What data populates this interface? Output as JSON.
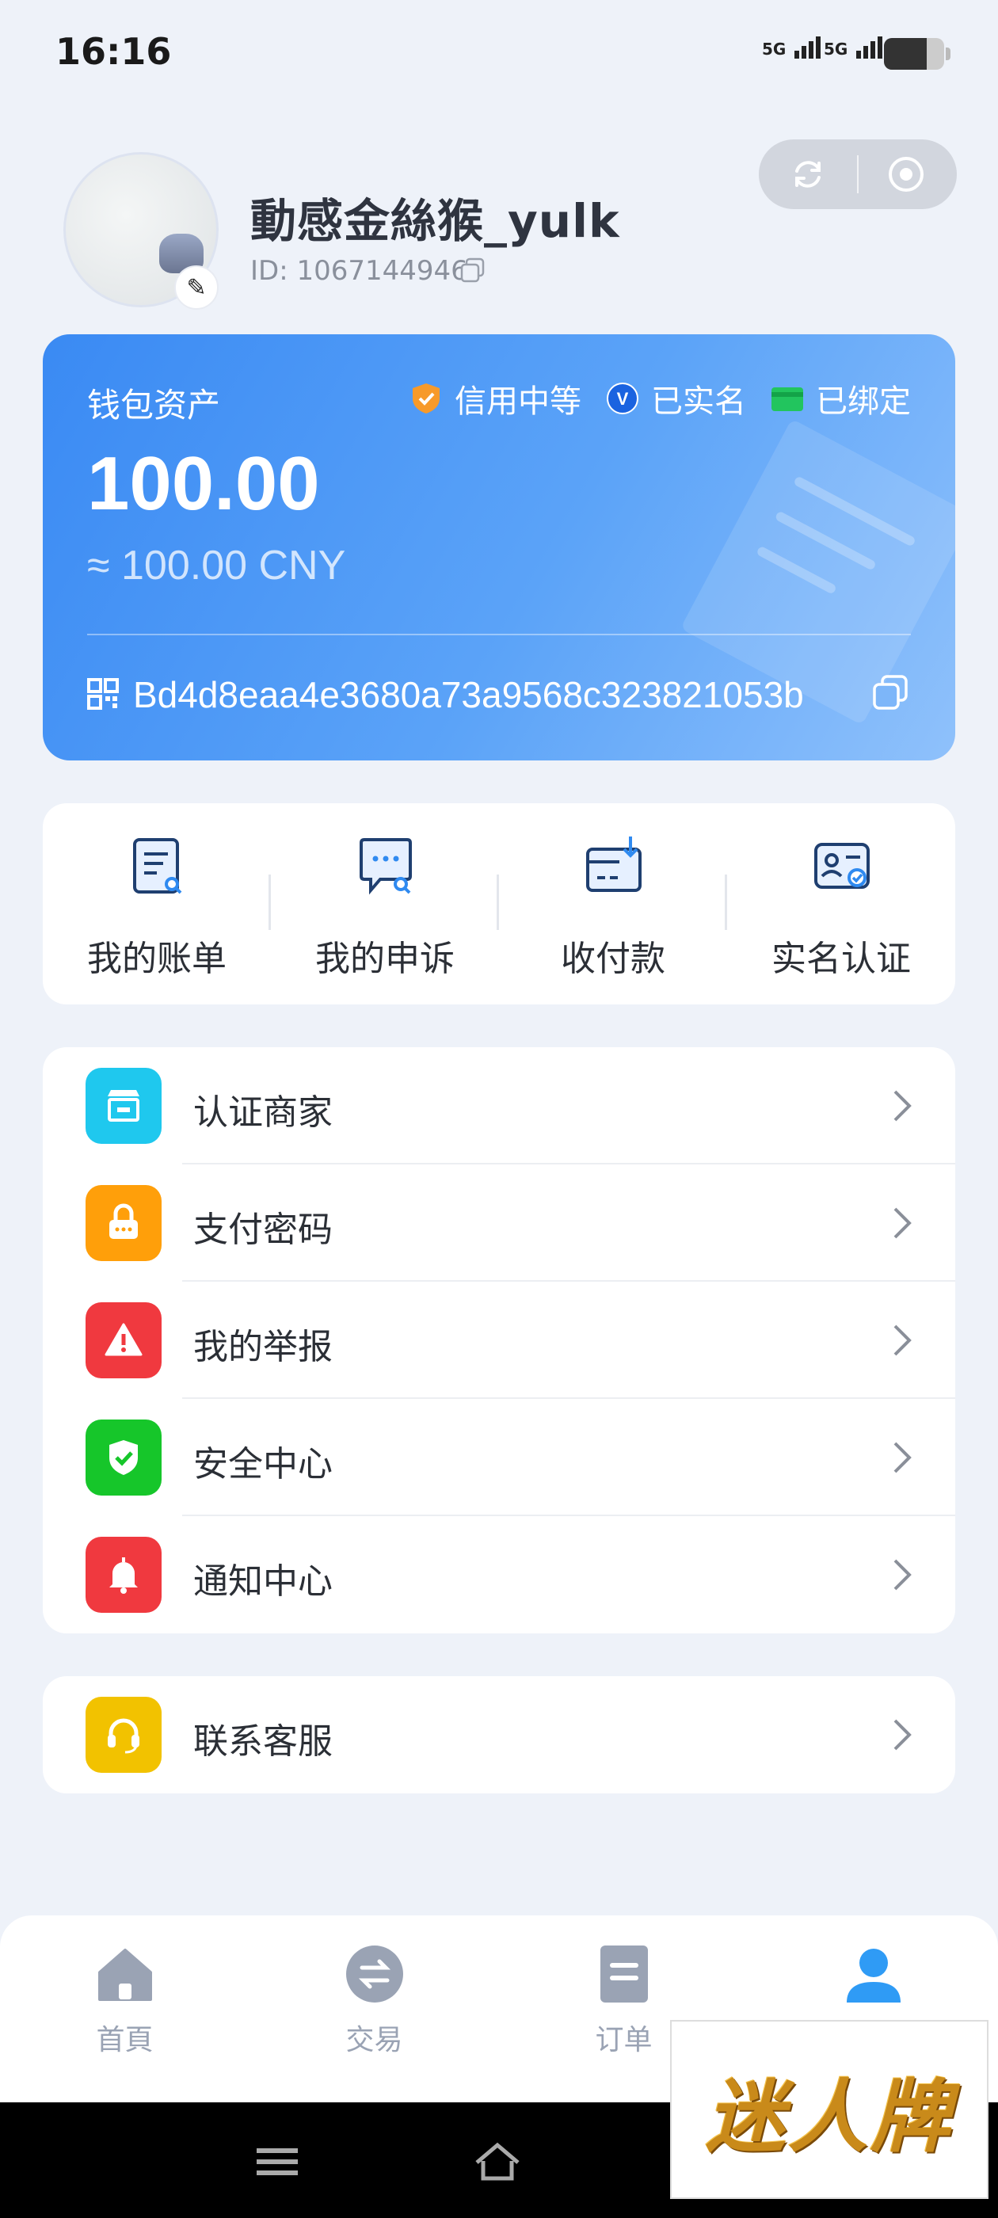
{
  "status_bar": {
    "time": "16:16",
    "signal_1": "5G",
    "signal_2": "5G"
  },
  "profile": {
    "nickname": "動感金絲猴_yulk",
    "uid": "ID: 1067144946",
    "edit_icon": "pencil-icon"
  },
  "wallet": {
    "title": "钱包资产",
    "amount": "100.00",
    "cny": "≈ 100.00 CNY",
    "tags": [
      {
        "label": "信用中等",
        "icon": "shield-icon",
        "color": "#f79a2a"
      },
      {
        "label": "已实名",
        "icon": "verified-icon",
        "color": "#1a63e0"
      },
      {
        "label": "已绑定",
        "icon": "card-icon",
        "color": "#22c55e"
      }
    ],
    "address": "Bd4d8eaa4e3680a73a9568c323821053b"
  },
  "quick_actions": [
    {
      "label": "我的账单",
      "icon": "bill-icon"
    },
    {
      "label": "我的申诉",
      "icon": "appeal-icon"
    },
    {
      "label": "收付款",
      "icon": "payment-icon"
    },
    {
      "label": "实名认证",
      "icon": "id-verify-icon"
    }
  ],
  "menu": [
    {
      "label": "认证商家",
      "icon": "store-icon",
      "color": "#1fc8ee"
    },
    {
      "label": "支付密码",
      "icon": "lock-icon",
      "color": "#ff9f0a"
    },
    {
      "label": "我的举报",
      "icon": "warning-icon",
      "color": "#f0393f"
    },
    {
      "label": "安全中心",
      "icon": "shield-check-icon",
      "color": "#16c62a"
    },
    {
      "label": "通知中心",
      "icon": "bell-icon",
      "color": "#f0393f"
    }
  ],
  "service": {
    "label": "联系客服",
    "icon": "headset-icon",
    "color": "#f2c200"
  },
  "tabbar": [
    {
      "label": "首頁",
      "icon": "home-icon"
    },
    {
      "label": "交易",
      "icon": "exchange-icon"
    },
    {
      "label": "订单",
      "icon": "order-icon"
    },
    {
      "label": "",
      "icon": "profile-icon",
      "active_color": "#2f9bf5"
    }
  ],
  "watermark": {
    "text": "迷人牌"
  }
}
